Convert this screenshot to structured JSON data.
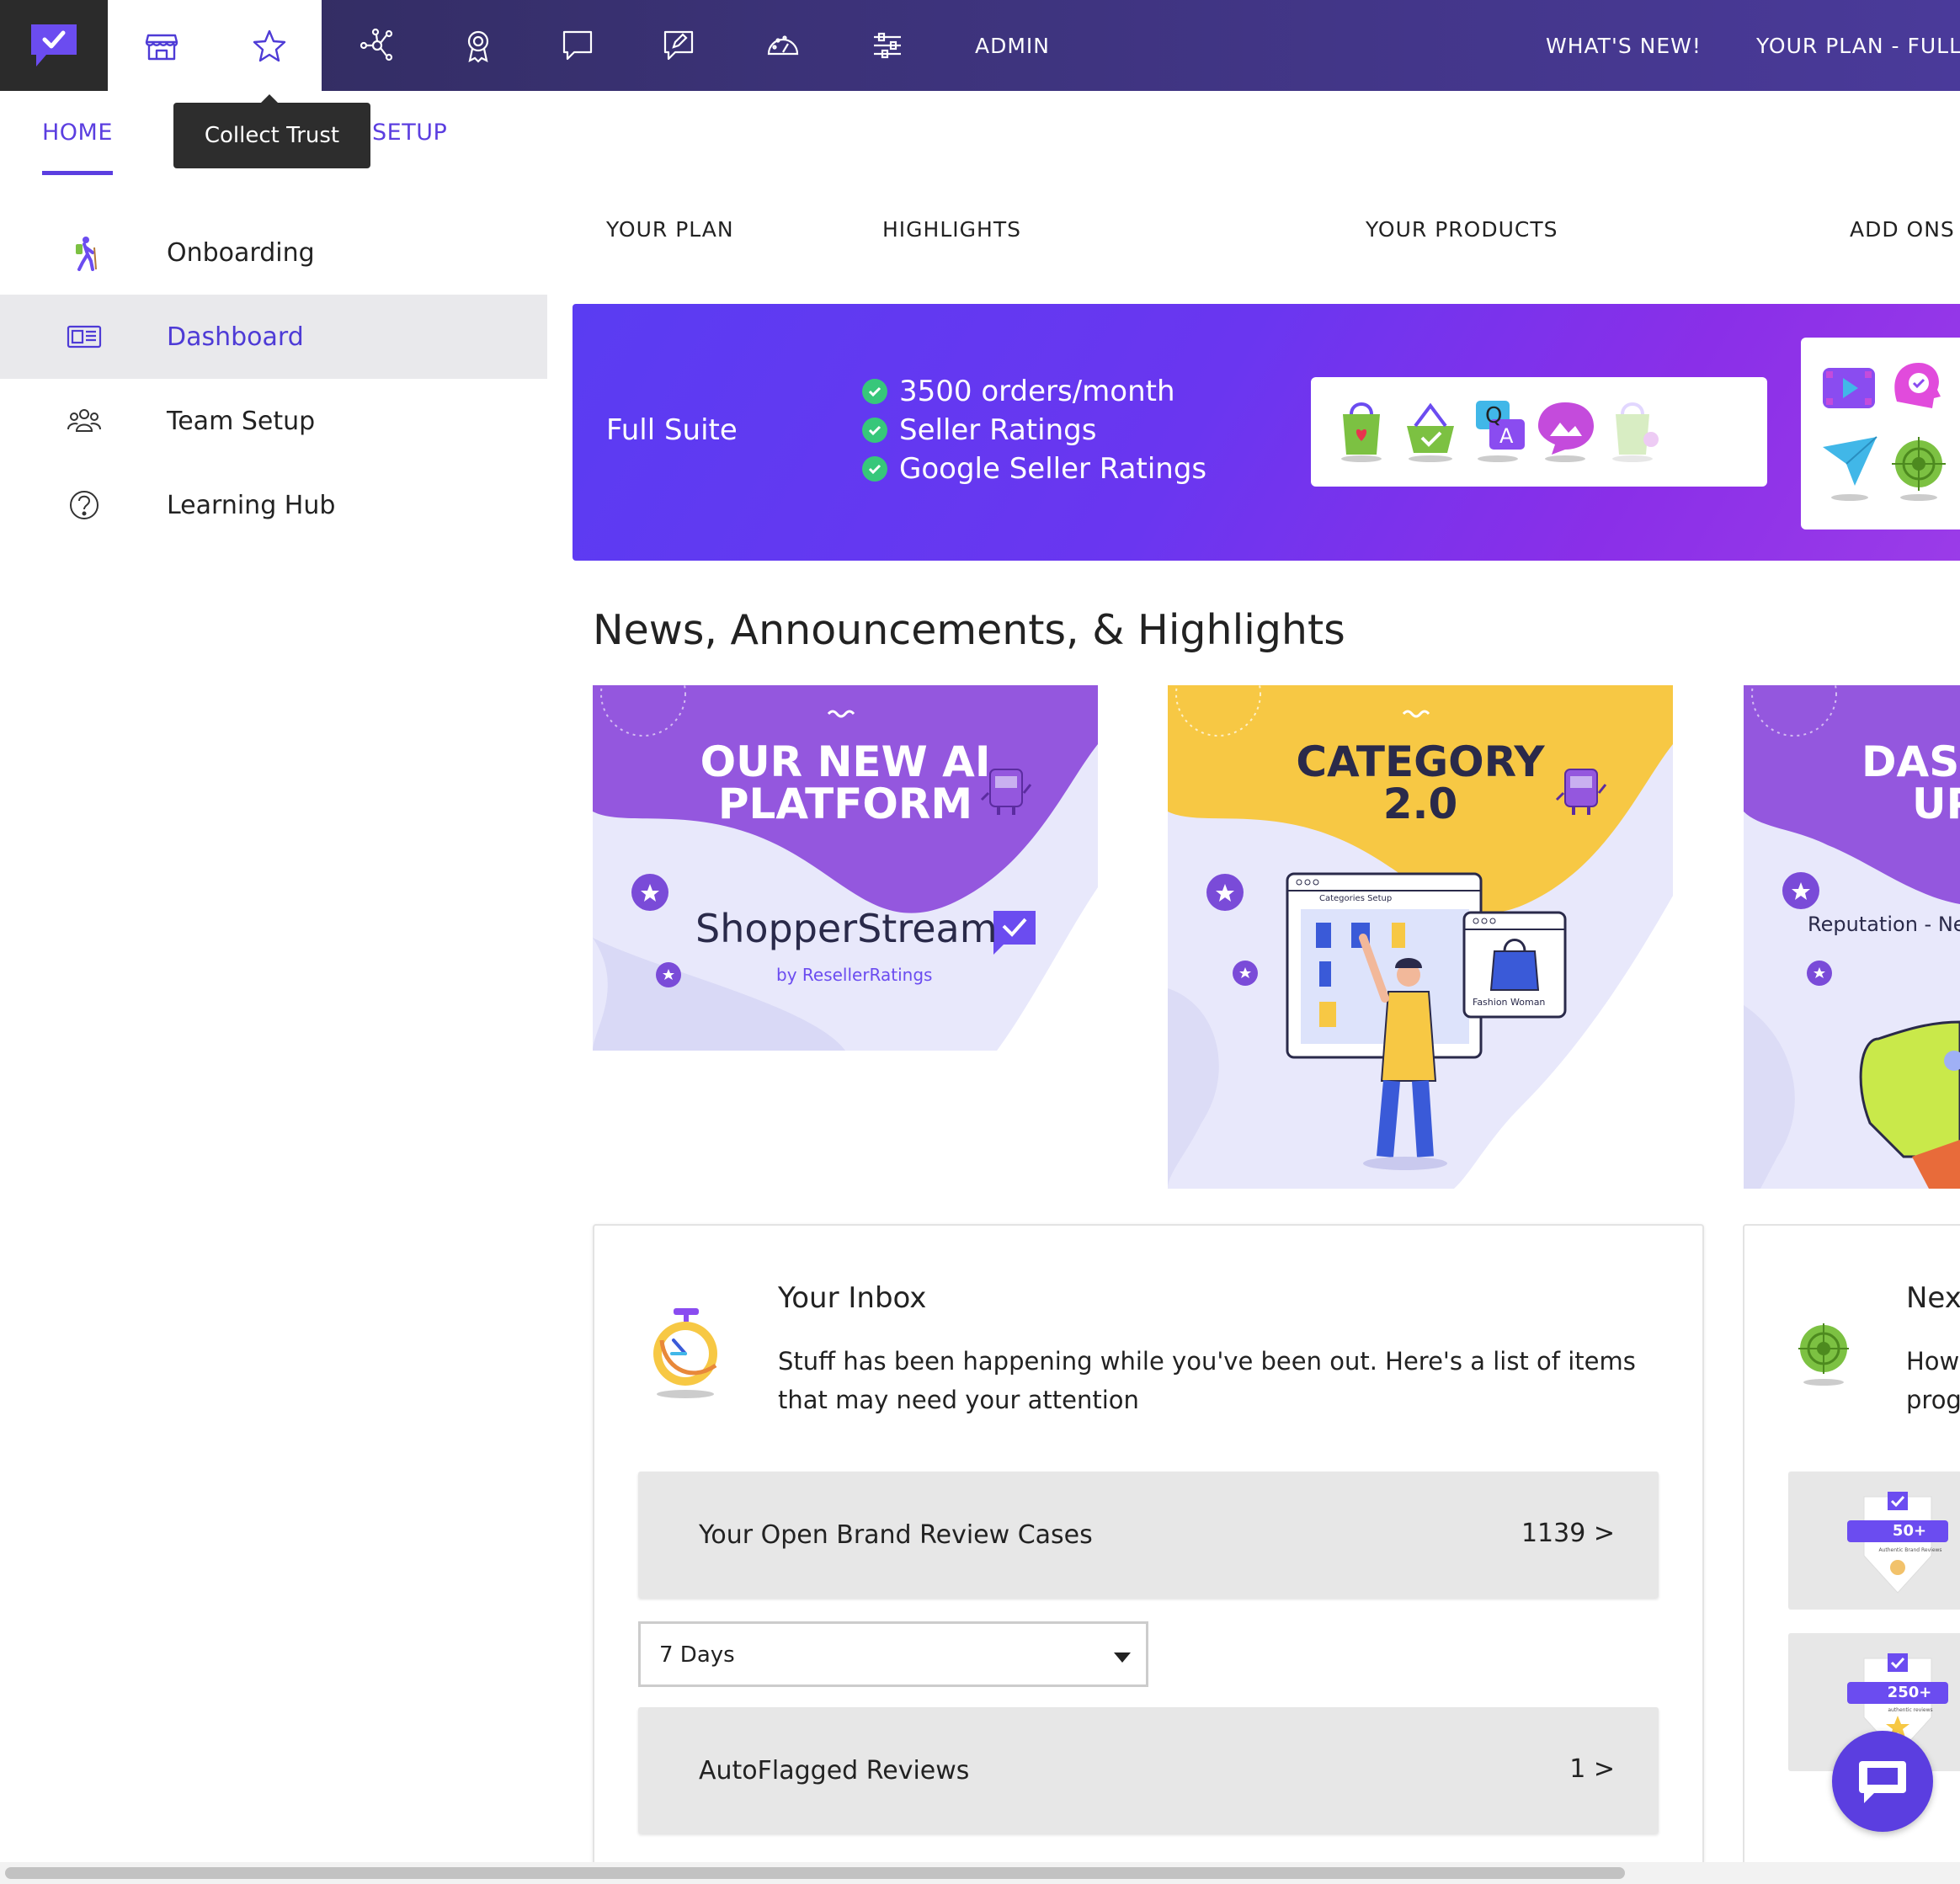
{
  "topbar": {
    "admin_label": "ADMIN",
    "whats_new_label": "WHAT'S NEW!",
    "plan_label": "YOUR PLAN - FULL SU",
    "icons": [
      "logo-check",
      "store",
      "star",
      "network",
      "award",
      "chat",
      "edit",
      "gauge",
      "sliders"
    ],
    "tooltip": "Collect Trust"
  },
  "subnav": {
    "home": "HOME",
    "setup": "SETUP"
  },
  "sidebar": {
    "items": [
      {
        "label": "Onboarding",
        "icon": "hiker-icon",
        "active": false
      },
      {
        "label": "Dashboard",
        "icon": "dashboard-icon",
        "active": true
      },
      {
        "label": "Team Setup",
        "icon": "team-icon",
        "active": false
      },
      {
        "label": "Learning Hub",
        "icon": "help-icon",
        "active": false
      }
    ]
  },
  "content_tabs": [
    "YOUR PLAN",
    "HIGHLIGHTS",
    "YOUR PRODUCTS",
    "ADD ONS"
  ],
  "banner": {
    "plan_name": "Full Suite",
    "features": [
      "3500 orders/month",
      "Seller Ratings",
      "Google Seller Ratings"
    ]
  },
  "news": {
    "title": "News, Announcements, & Highlights",
    "cards": [
      {
        "headline_1": "OUR NEW AI",
        "headline_2": "PLATFORM",
        "brand": "ShopperStream",
        "byline": "by ResellerRatings"
      },
      {
        "headline_1": "CATEGORY",
        "headline_2": "2.0",
        "window_title": "Categories Setup",
        "window_label": "Fashion Woman"
      },
      {
        "headline_1": "DASH",
        "headline_2": "UP",
        "subtitle": "Reputation - Ne"
      }
    ]
  },
  "inbox": {
    "title": "Your Inbox",
    "description": "Stuff has been happening while you've been out. Here's a list of items that may need your attention",
    "rows": [
      {
        "label": "Your Open Brand Review Cases",
        "count": "1139 >"
      },
      {
        "label": "AutoFlagged Reviews",
        "count": "1 >"
      }
    ],
    "period_select": "7 Days"
  },
  "next_card": {
    "title": "Next",
    "desc_1": "How",
    "desc_2": "prog",
    "badges": [
      {
        "count": "50+",
        "caption": "Authentic Brand Reviews"
      },
      {
        "count": "250+",
        "caption": "authentic reviews"
      }
    ]
  },
  "colors": {
    "accent": "#5b3ee0",
    "topbar": "#3b3277",
    "banner_start": "#5a3cf2",
    "banner_end": "#9b3ce8",
    "check_green": "#37c77a"
  }
}
